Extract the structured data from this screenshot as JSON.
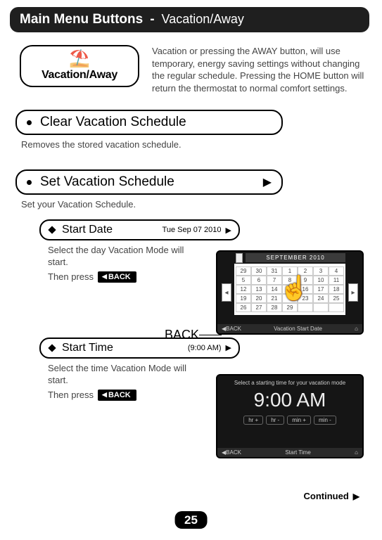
{
  "header": {
    "main": "Main Menu Buttons",
    "dash": "-",
    "sub": "Vacation/Away"
  },
  "vacBox": {
    "label": "Vacation/Away"
  },
  "introText": "Vacation or pressing the AWAY button, will use temporary, energy saving settings without changing the regular schedule. Pressing the HOME button will return the thermostat to normal comfort settings.",
  "menu1": {
    "label": "Clear Vacation Schedule",
    "desc": "Removes the stored vacation schedule."
  },
  "menu2": {
    "label": "Set Vacation Schedule",
    "desc": "Set your Vacation Schedule."
  },
  "startDate": {
    "label": "Start Date",
    "right": "Tue Sep 07 2010",
    "desc": "Select the day Vacation Mode will start.",
    "thenPress": "Then press",
    "backBadge": "BACK"
  },
  "startTime": {
    "label": "Start Time",
    "right": "(9:00 AM)",
    "desc": "Select the time Vacation Mode will start.",
    "thenPress": "Then press",
    "backBadge": "BACK"
  },
  "backPointer": "BACK",
  "screenCal": {
    "month": "SEPTEMBER 2010",
    "footLeft": "◀BACK",
    "footCenter": "Vacation Start Date"
  },
  "screenTime": {
    "msg": "Select a starting time for your vacation mode",
    "time": "9:00 AM",
    "buttons": [
      "hr +",
      "hr -",
      "min +",
      "min -"
    ],
    "footLeft": "◀BACK",
    "footCenter": "Start Time"
  },
  "continued": "Continued",
  "pageNum": "25"
}
